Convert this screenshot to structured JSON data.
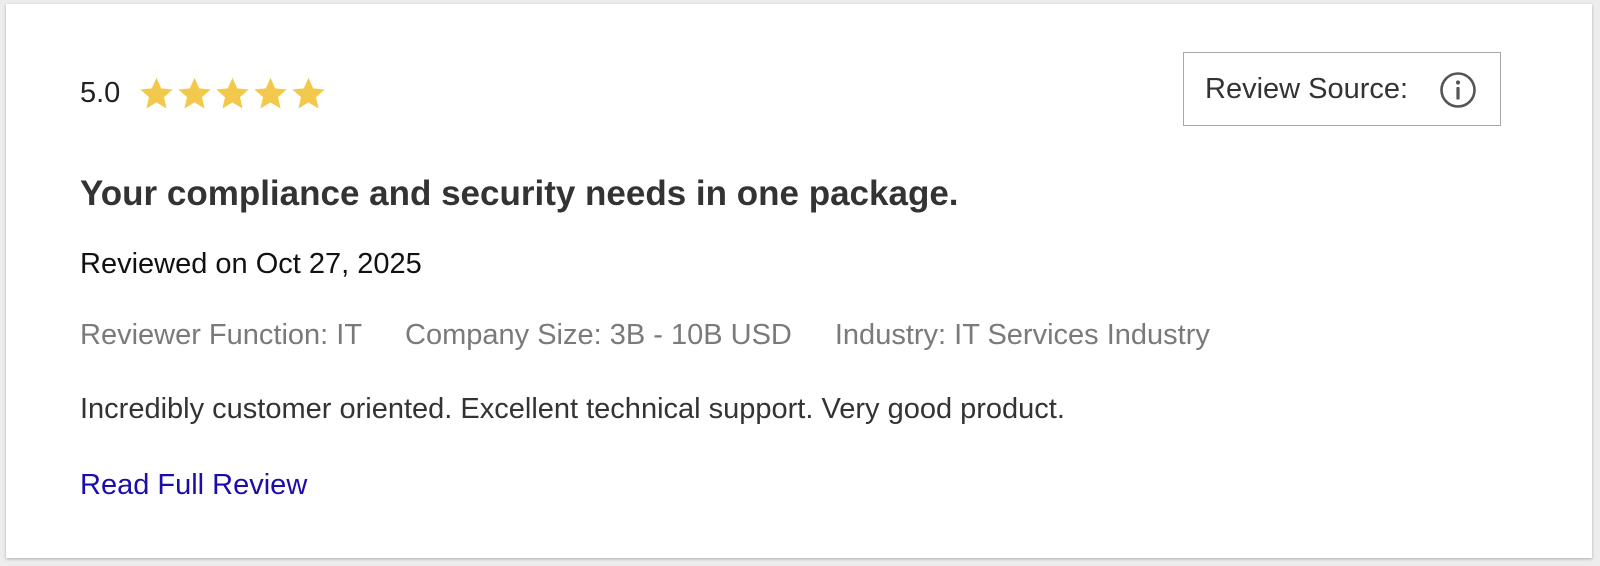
{
  "review": {
    "rating": "5.0",
    "stars": {
      "filled": 5,
      "total": 5,
      "color": "#f2c94c",
      "icon": "star-icon"
    },
    "source_label": "Review Source:",
    "source_icon": "info-icon",
    "title": "Your compliance and security needs in one package.",
    "date": "Reviewed on Oct 27, 2025",
    "meta": {
      "function": "Reviewer Function: IT",
      "company_size": "Company Size: 3B - 10B USD",
      "industry": "Industry: IT Services Industry"
    },
    "body": "Incredibly customer oriented. Excellent technical support. Very good product.",
    "link_label": "Read Full Review",
    "link_color": "#1a0dab"
  }
}
